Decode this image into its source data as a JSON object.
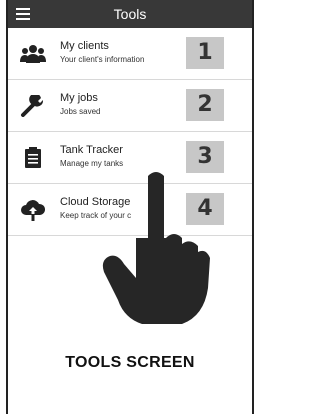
{
  "header": {
    "title": "Tools",
    "menu_icon": "hamburger-menu-icon"
  },
  "tools": [
    {
      "label": "My clients",
      "sub": "Your client's information",
      "icon": "people-icon",
      "number": "1"
    },
    {
      "label": "My jobs",
      "sub": "Jobs saved",
      "icon": "wrench-icon",
      "number": "2"
    },
    {
      "label": "Tank Tracker",
      "sub": "Manage my tanks",
      "icon": "clipboard-icon",
      "number": "3"
    },
    {
      "label": "Cloud Storage",
      "sub": "Keep track of your c",
      "icon": "cloud-upload-icon",
      "number": "4"
    }
  ],
  "overlay": {
    "pointer_icon": "pointing-hand-icon",
    "caption": "TOOLS SCREEN"
  },
  "colors": {
    "topbar": "#383838",
    "badge": "#c7c7c7",
    "hand": "#262626"
  }
}
